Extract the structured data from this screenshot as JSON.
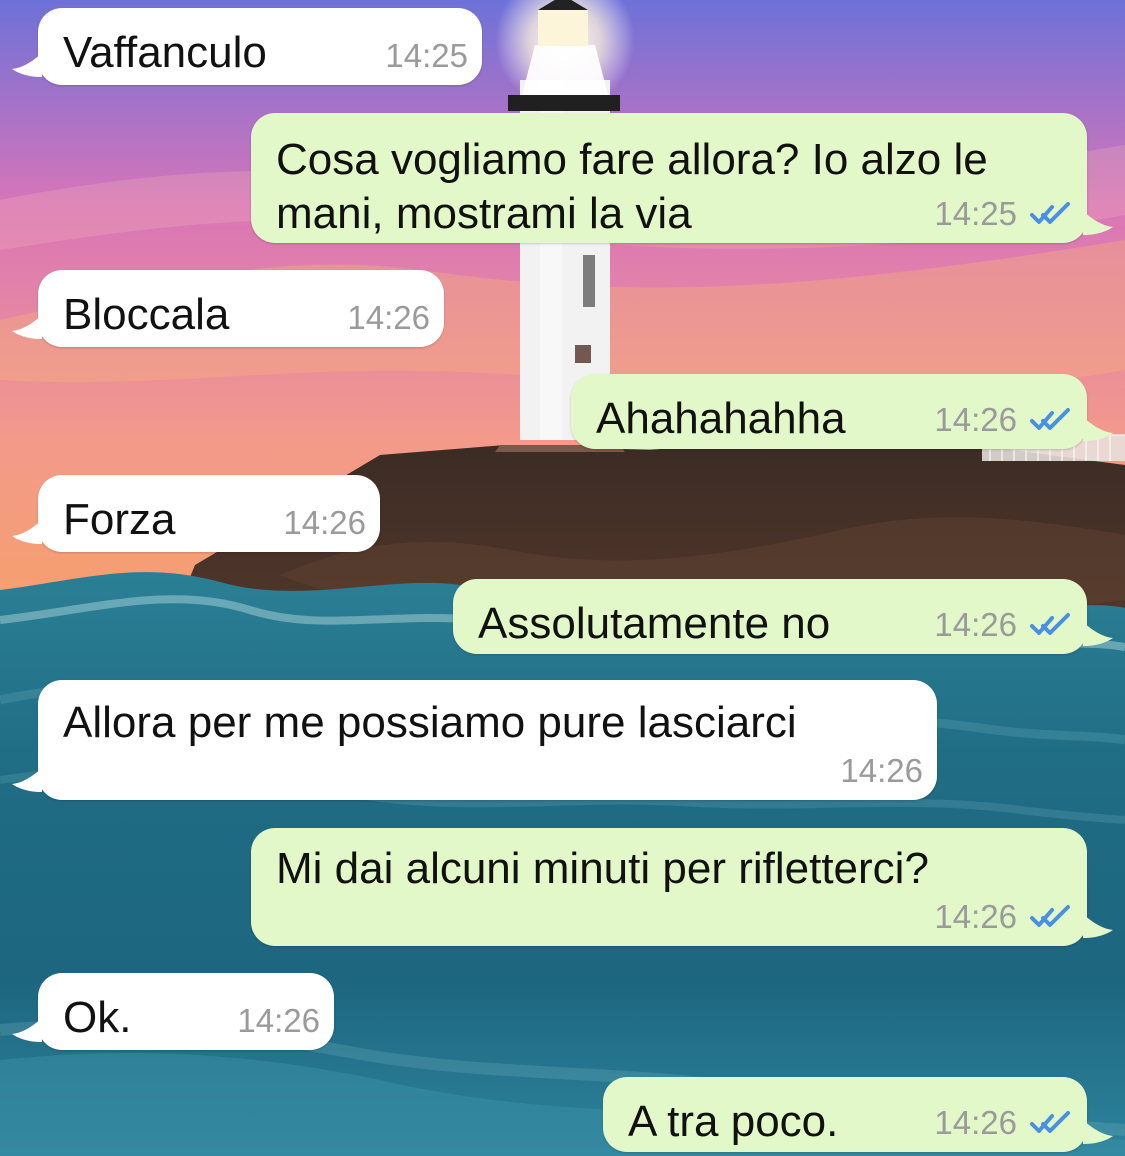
{
  "app": {
    "colors": {
      "incoming_bubble": "#ffffff",
      "outgoing_bubble": "#e2f8c9",
      "text": "#111111",
      "timestamp": "#9a9a9a",
      "read_ticks": "#4a90e2"
    }
  },
  "messages": [
    {
      "direction": "incoming",
      "text": "Vaffanculo",
      "time": "14:25"
    },
    {
      "direction": "outgoing",
      "text": "Cosa vogliamo fare allora? Io alzo le\nmani, mostrami la via",
      "time": "14:25",
      "status_icon": "double-check-icon"
    },
    {
      "direction": "incoming",
      "text": "Bloccala",
      "time": "14:26"
    },
    {
      "direction": "outgoing",
      "text": "Ahahahahha",
      "time": "14:26",
      "status_icon": "double-check-icon"
    },
    {
      "direction": "incoming",
      "text": "Forza",
      "time": "14:26"
    },
    {
      "direction": "outgoing",
      "text": "Assolutamente no",
      "time": "14:26",
      "status_icon": "double-check-icon"
    },
    {
      "direction": "incoming",
      "text": "Allora per me possiamo pure lasciarci",
      "time": "14:26"
    },
    {
      "direction": "outgoing",
      "text": "Mi dai alcuni minuti per rifletterci?",
      "time": "14:26",
      "status_icon": "double-check-icon"
    },
    {
      "direction": "incoming",
      "text": "Ok.",
      "time": "14:26"
    },
    {
      "direction": "outgoing",
      "text": "A tra poco.",
      "time": "14:26",
      "status_icon": "double-check-icon"
    }
  ]
}
